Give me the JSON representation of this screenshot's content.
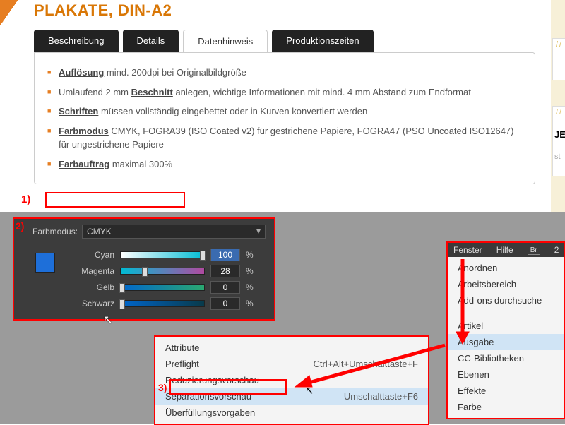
{
  "page": {
    "title": "PLAKATE, DIN-A2"
  },
  "tabs": [
    {
      "label": "Beschreibung"
    },
    {
      "label": "Details"
    },
    {
      "label": "Datenhinweis"
    },
    {
      "label": "Produktionszeiten"
    }
  ],
  "hints": [
    {
      "term": "Auflösung",
      "rest": " mind. 200dpi bei Originalbildgröße"
    },
    {
      "pre": "Umlaufend 2 mm ",
      "term": "Beschnitt",
      "rest": " anlegen, wichtige Informationen mit mind. 4 mm Abstand zum Endformat"
    },
    {
      "term": "Schriften",
      "rest": " müssen vollständig eingebettet oder in Kurven konvertiert werden"
    },
    {
      "term": "Farbmodus",
      "rest": " CMYK, FOGRA39 (ISO Coated v2) für gestrichene Papiere, FOGRA47 (PSO Uncoated ISO12647) für ungestrichene Papiere"
    },
    {
      "term": "Farbauftrag",
      "rest": " maximal 300%"
    }
  ],
  "annotations": {
    "a1": "1)",
    "a2": "2)",
    "a3": "3)"
  },
  "cmyk": {
    "mode_label": "Farbmodus:",
    "mode_value": "CMYK",
    "channels": [
      {
        "name": "Cyan",
        "value": "100",
        "pos": 100
      },
      {
        "name": "Magenta",
        "value": "28",
        "pos": 28
      },
      {
        "name": "Gelb",
        "value": "0",
        "pos": 0
      },
      {
        "name": "Schwarz",
        "value": "0",
        "pos": 0
      }
    ],
    "pct": "%"
  },
  "fenster": {
    "bar": {
      "fenster": "Fenster",
      "hilfe": "Hilfe",
      "br": "Br",
      "num": "2"
    },
    "items_top": [
      "Anordnen",
      "Arbeitsbereich",
      "Add-ons durchsuche"
    ],
    "items_bot": [
      "Artikel",
      "Ausgabe",
      "CC-Bibliotheken",
      "Ebenen",
      "Effekte",
      "Farbe"
    ],
    "highlight": "Ausgabe"
  },
  "submenu": {
    "items": [
      {
        "label": "Attribute",
        "sc": ""
      },
      {
        "label": "Preflight",
        "sc": "Ctrl+Alt+Umschalttaste+F"
      },
      {
        "label": "Reduzierungsvorschau",
        "sc": ""
      },
      {
        "label": "Separationsvorschau",
        "sc": "Umschalttaste+F6"
      },
      {
        "label": "Überfüllungsvorgaben",
        "sc": ""
      }
    ],
    "highlight": "Separationsvorschau"
  },
  "sidebar": {
    "slashes": "//",
    "je": "JE",
    "st": "st"
  },
  "chart_data": {
    "type": "table",
    "title": "CMYK Farbwerte",
    "series": [
      {
        "name": "Cyan",
        "values": [
          100
        ]
      },
      {
        "name": "Magenta",
        "values": [
          28
        ]
      },
      {
        "name": "Gelb",
        "values": [
          0
        ]
      },
      {
        "name": "Schwarz",
        "values": [
          0
        ]
      }
    ],
    "ylim": [
      0,
      100
    ],
    "ylabel": "%"
  }
}
